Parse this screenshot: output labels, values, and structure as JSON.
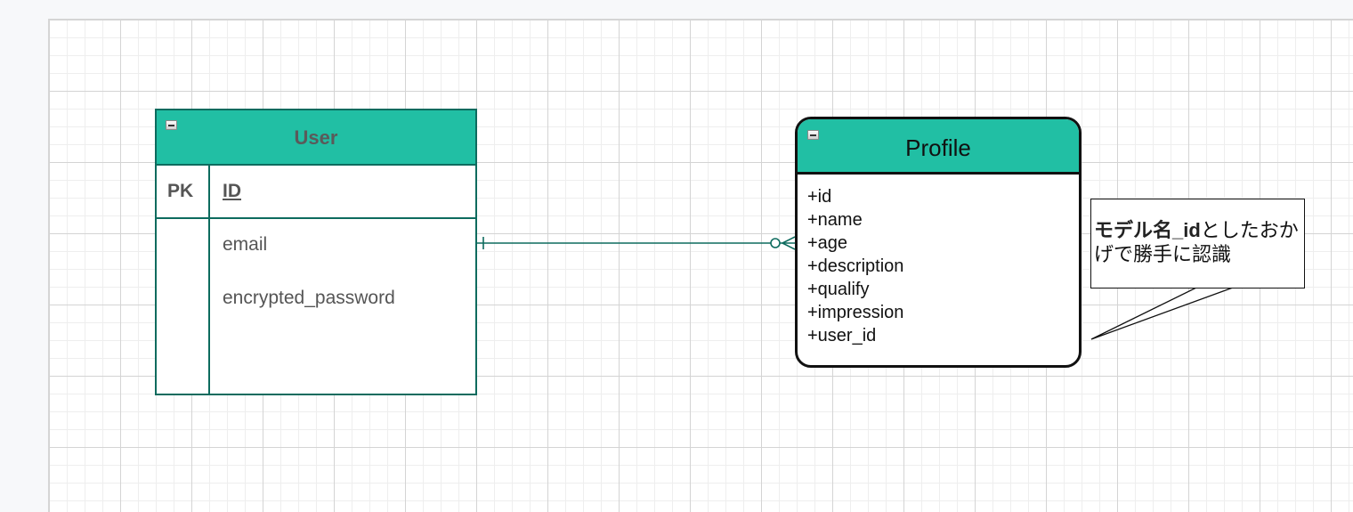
{
  "user_entity": {
    "title": "User",
    "pk_label": "PK",
    "pk_field": "ID",
    "fields": [
      "email",
      "encrypted_password"
    ]
  },
  "profile_entity": {
    "title": "Profile",
    "attributes": [
      "+id",
      "+name",
      "+age",
      "+description",
      "+qualify",
      "+impression",
      "+user_id"
    ]
  },
  "callout": {
    "bold_text": "モデル名_id",
    "text_rest": "としたおかげで勝手に認識"
  },
  "relationship": {
    "from": "User",
    "to": "Profile",
    "from_cardinality": "one",
    "to_cardinality": "zero-or-many"
  },
  "colors": {
    "header_fill": "#21bfa4",
    "entity_border": "#0d6b5e",
    "grid_line": "#d4d4d4",
    "canvas_bg": "#ffffff"
  }
}
